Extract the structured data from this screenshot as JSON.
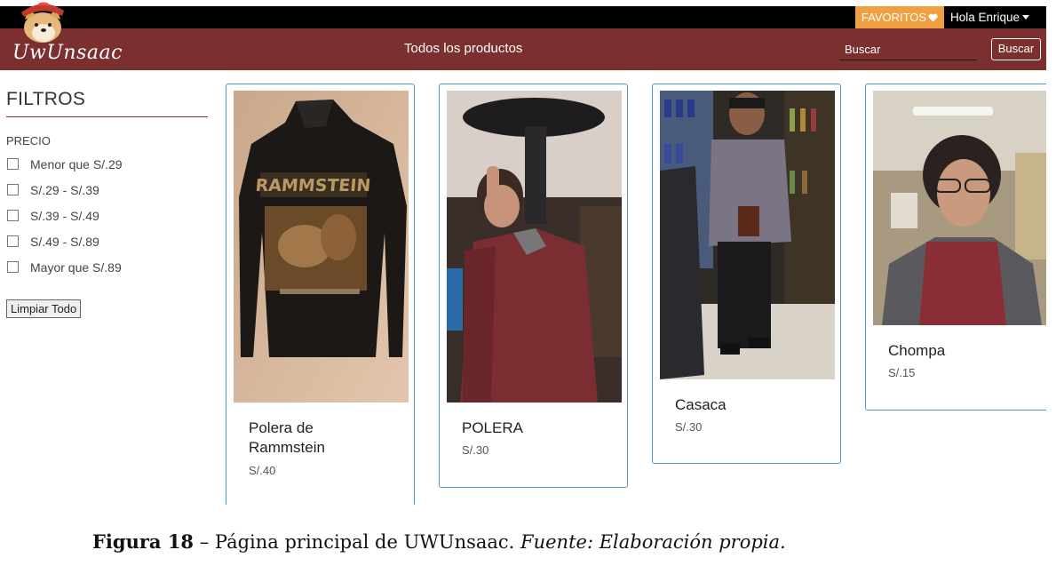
{
  "header": {
    "favorites_label": "FAVORITOS",
    "user_menu_label": "Hola Enrique",
    "logo_text": "UwUnsaac",
    "nav_title": "Todos los productos",
    "search_placeholder": "Buscar",
    "search_button": "Buscar"
  },
  "filters": {
    "title": "FILTROS",
    "precio_label": "PRECIO",
    "options": [
      "Menor que S/.29",
      "S/.29 - S/.39",
      "S/.39 - S/.49",
      "S/.49 - S/.89",
      "Mayor que S/.89"
    ],
    "clear_button": "Limpiar Todo"
  },
  "products": [
    {
      "name": "Polera de Rammstein",
      "price": "S/.40",
      "image": "black-jacket-rammstein-photo"
    },
    {
      "name": "POLERA",
      "price": "S/.30",
      "image": "person-maroon-hoodie-photo"
    },
    {
      "name": "Casaca",
      "price": "S/.30",
      "image": "person-grey-jacket-store-photo"
    },
    {
      "name": "Chompa",
      "price": "S/.15",
      "image": "person-red-sweater-photo"
    }
  ],
  "caption": {
    "figure_label": "Figura 18",
    "text": " – Página principal de UWUnsaac. ",
    "source": "Fuente: Elaboración propia."
  },
  "colors": {
    "navbar": "#7b2f2f",
    "topbar": "#000000",
    "favorites": "#f0a040",
    "card_border": "#4a9ad8"
  }
}
